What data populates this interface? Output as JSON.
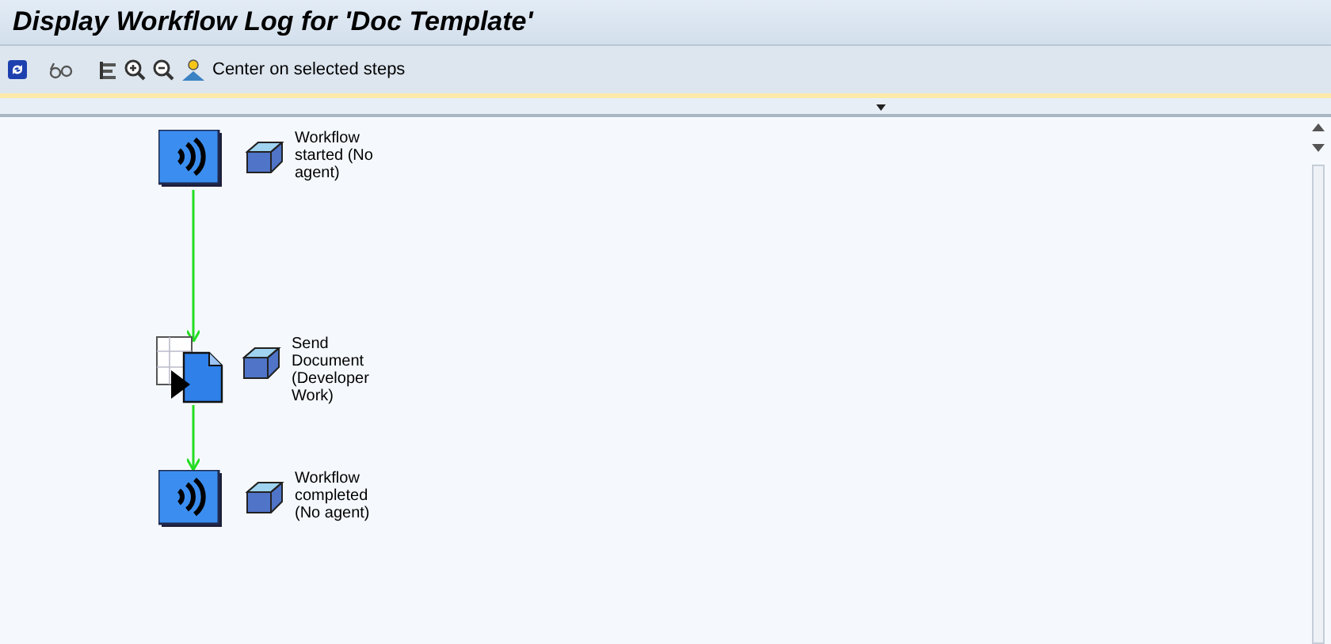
{
  "window": {
    "title": "Display Workflow Log for 'Doc Template'"
  },
  "toolbar": [
    {
      "kind": "refresh"
    },
    {
      "kind": "glasses"
    },
    {
      "kind": "legend"
    },
    {
      "kind": "zoom-in"
    },
    {
      "kind": "zoom-out"
    },
    {
      "kind": "center",
      "label": "Center on selected steps"
    }
  ],
  "steps": [
    {
      "kind": "event",
      "label": "Workflow started (No agent)"
    },
    {
      "kind": "document",
      "label": "Send Document (Developer Work)"
    },
    {
      "kind": "event",
      "label": "Workflow completed (No agent)"
    }
  ]
}
